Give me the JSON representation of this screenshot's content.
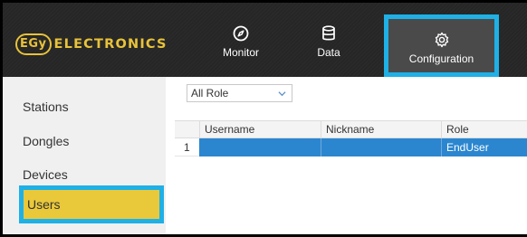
{
  "brand": {
    "badge": "EGy",
    "name": "ELECTRONICS"
  },
  "nav": [
    {
      "label": "Monitor",
      "icon": "compass-icon"
    },
    {
      "label": "Data",
      "icon": "database-icon"
    },
    {
      "label": "Configuration",
      "icon": "gear-icon",
      "active": true
    }
  ],
  "sidebar": {
    "items": [
      {
        "label": "Stations"
      },
      {
        "label": "Dongles"
      },
      {
        "label": "Devices"
      },
      {
        "label": "Users",
        "active": true
      }
    ]
  },
  "filter": {
    "role_value": "All Role"
  },
  "table": {
    "headers": [
      "",
      "Username",
      "Nickname",
      "Role"
    ],
    "rows": [
      {
        "index": "1",
        "username": "",
        "nickname": "",
        "role": "EndUser",
        "selected": true
      }
    ]
  },
  "colors": {
    "accent_gold": "#e8c23a",
    "highlight_blue": "#1fb0e6",
    "row_selected": "#2b86cf"
  }
}
